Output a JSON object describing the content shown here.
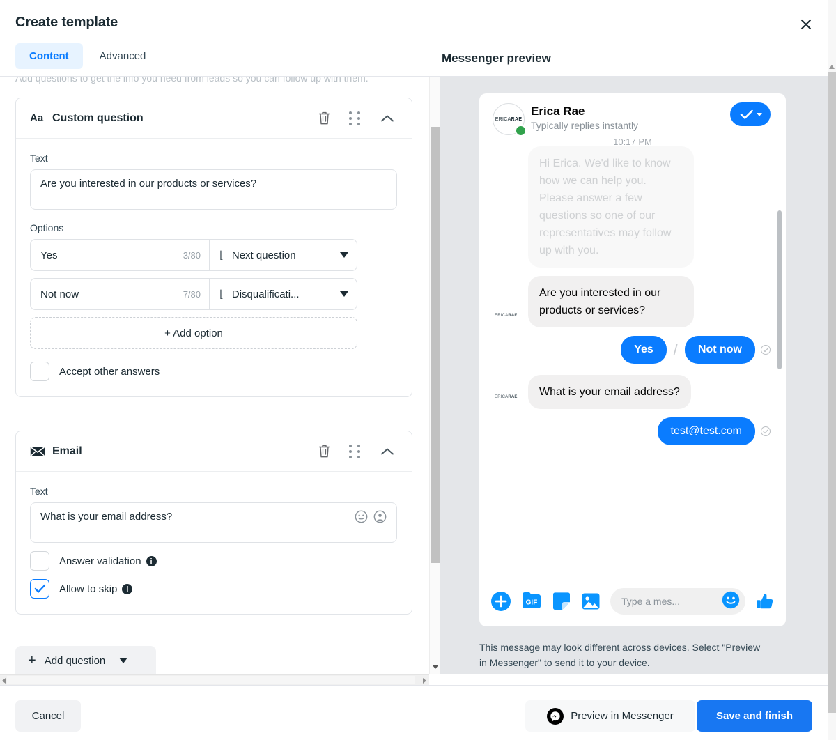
{
  "dialog": {
    "title": "Create template",
    "close_icon": "close-icon",
    "hint": "Add questions to get the info you need from leads so you can follow up with them.",
    "tabs": [
      {
        "label": "Content",
        "active": true
      },
      {
        "label": "Advanced",
        "active": false
      }
    ],
    "preview_heading": "Messenger preview"
  },
  "questions": [
    {
      "type_icon": "Aa",
      "title": "Custom question",
      "text_label": "Text",
      "text_value": "Are you interested in our products or services?",
      "options_label": "Options",
      "options": [
        {
          "value": "Yes",
          "count": "3/80",
          "target": "Next question"
        },
        {
          "value": "Not now",
          "count": "7/80",
          "target": "Disqualificati..."
        }
      ],
      "add_option_label": "+ Add option",
      "accept_other_label": "Accept other answers",
      "accept_other_checked": false
    },
    {
      "type_icon": "envelope-icon",
      "title": "Email",
      "text_label": "Text",
      "text_value": "What is your email address?",
      "toggles": [
        {
          "label": "Answer validation",
          "checked": false
        },
        {
          "label": "Allow to skip",
          "checked": true
        }
      ]
    }
  ],
  "add_question_label": "Add question",
  "preview": {
    "contact_name": "Erica Rae",
    "contact_status": "Typically replies instantly",
    "avatar_text_light": "ERICA",
    "avatar_text_bold": "RAE",
    "timestamp": "10:17 PM",
    "messages": [
      {
        "from": "page",
        "faded": true,
        "text": "Hi Erica. We'd like to know how we can help you. Please answer a few questions so one of our representatives may follow up with you."
      },
      {
        "from": "page",
        "faded": false,
        "text": "Are you interested in our products or services?"
      },
      {
        "from": "user",
        "kind": "quick_replies",
        "options": [
          "Yes",
          "Not now"
        ]
      },
      {
        "from": "page",
        "faded": false,
        "text": "What is your email address?"
      },
      {
        "from": "user",
        "kind": "text",
        "text": "test@test.com"
      }
    ],
    "composer": {
      "plus_icon": "plus-circle-icon",
      "gif_label": "GIF",
      "sticker_icon": "sticker-icon",
      "image_icon": "image-icon",
      "placeholder": "Type a mes...",
      "emoji_icon": "emoji-icon",
      "like_icon": "thumbs-up-icon"
    },
    "disclaimer": "This message may look different across devices. Select \"Preview in Messenger\" to send it to your device."
  },
  "footer": {
    "cancel_label": "Cancel",
    "preview_label": "Preview in Messenger",
    "save_label": "Save and finish"
  },
  "colors": {
    "accent_blue": "#0a7cff",
    "primary_button": "#1877f2",
    "tab_active_bg": "#e7f3ff",
    "online_green": "#31a24c",
    "incoming_bubble": "#f1f0f0"
  }
}
